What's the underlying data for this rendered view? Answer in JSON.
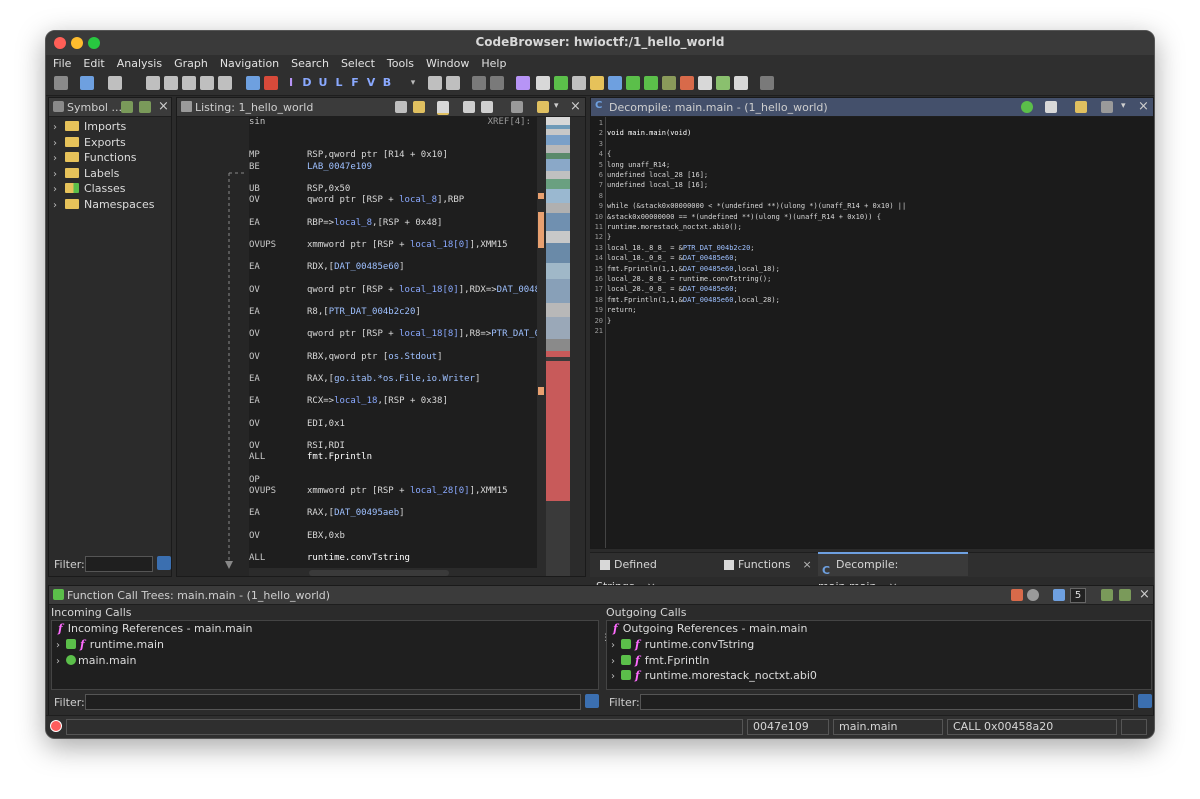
{
  "window": {
    "title": "CodeBrowser: hwioctf:/1_hello_world"
  },
  "menu": [
    "File",
    "Edit",
    "Analysis",
    "Graph",
    "Navigation",
    "Search",
    "Select",
    "Tools",
    "Window",
    "Help"
  ],
  "toolbar": {
    "letters": [
      "I",
      "D",
      "U",
      "L",
      "F",
      "V",
      "B"
    ]
  },
  "symbol_tree": {
    "title": "Symbol ...",
    "items": [
      "Imports",
      "Exports",
      "Functions",
      "Labels",
      "Classes",
      "Namespaces"
    ],
    "filter_label": "Filter:"
  },
  "listing": {
    "title": "Listing:  1_hello_world",
    "xref": "XREF[4]:",
    "lines": [
      {
        "mn": "sin",
        "ops": []
      },
      {
        "mn": "MP",
        "ops": [
          {
            "t": "RSP,qword ptr [R14 + 0x10]",
            "c": "op"
          }
        ]
      },
      {
        "mn": "BE",
        "ops": [
          {
            "t": "LAB_0047e109",
            "c": "dat"
          }
        ]
      },
      {
        "mn": "UB",
        "ops": [
          {
            "t": "RSP,0x50",
            "c": "op"
          }
        ]
      },
      {
        "mn": "OV",
        "ops": [
          {
            "t": "qword ptr [RSP + ",
            "c": "op"
          },
          {
            "t": "local_8",
            "c": "var"
          },
          {
            "t": "],RBP",
            "c": "op"
          }
        ]
      },
      {
        "mn": "EA",
        "ops": [
          {
            "t": "RBP=>",
            "c": "op"
          },
          {
            "t": "local_8",
            "c": "var"
          },
          {
            "t": ",[RSP + 0x48]",
            "c": "op"
          }
        ]
      },
      {
        "mn": "OVUPS",
        "ops": [
          {
            "t": "xmmword ptr [RSP + ",
            "c": "op"
          },
          {
            "t": "local_18[0]",
            "c": "var"
          },
          {
            "t": "],XMM15",
            "c": "op"
          }
        ]
      },
      {
        "mn": "EA",
        "ops": [
          {
            "t": "RDX,[",
            "c": "op"
          },
          {
            "t": "DAT_00485e60",
            "c": "dat"
          },
          {
            "t": "]",
            "c": "op"
          }
        ]
      },
      {
        "mn": "OV",
        "ops": [
          {
            "t": "qword ptr [RSP + ",
            "c": "op"
          },
          {
            "t": "local_18[0]",
            "c": "var"
          },
          {
            "t": "],RDX=>",
            "c": "op"
          },
          {
            "t": "DAT_00485e60",
            "c": "dat"
          }
        ]
      },
      {
        "mn": "EA",
        "ops": [
          {
            "t": "R8,[",
            "c": "op"
          },
          {
            "t": "PTR_DAT_004b2c20",
            "c": "dat"
          },
          {
            "t": "]",
            "c": "op"
          }
        ]
      },
      {
        "mn": "OV",
        "ops": [
          {
            "t": "qword ptr [RSP + ",
            "c": "op"
          },
          {
            "t": "local_18[8]",
            "c": "var"
          },
          {
            "t": "],R8=>",
            "c": "op"
          },
          {
            "t": "PTR_DAT_004b2",
            "c": "dat"
          }
        ]
      },
      {
        "mn": "OV",
        "ops": [
          {
            "t": "RBX,qword ptr [",
            "c": "op"
          },
          {
            "t": "os.Stdout",
            "c": "dat"
          },
          {
            "t": "]",
            "c": "op"
          }
        ]
      },
      {
        "mn": "EA",
        "ops": [
          {
            "t": "RAX,[",
            "c": "op"
          },
          {
            "t": "go.itab.*os.File,io.Writer",
            "c": "dat"
          },
          {
            "t": "]",
            "c": "op"
          }
        ]
      },
      {
        "mn": "EA",
        "ops": [
          {
            "t": "RCX=>",
            "c": "op"
          },
          {
            "t": "local_18",
            "c": "var"
          },
          {
            "t": ",[RSP + 0x38]",
            "c": "op"
          }
        ]
      },
      {
        "mn": "OV",
        "ops": [
          {
            "t": "EDI,0x1",
            "c": "op"
          }
        ]
      },
      {
        "mn": "OV",
        "ops": [
          {
            "t": "RSI,RDI",
            "c": "op"
          }
        ]
      },
      {
        "mn": "ALL",
        "ops": [
          {
            "t": "fmt.Fprintln",
            "c": "fn"
          }
        ]
      },
      {
        "mn": "OP",
        "ops": []
      },
      {
        "mn": "OVUPS",
        "ops": [
          {
            "t": "xmmword ptr [RSP + ",
            "c": "op"
          },
          {
            "t": "local_28[0]",
            "c": "var"
          },
          {
            "t": "],XMM15",
            "c": "op"
          }
        ]
      },
      {
        "mn": "EA",
        "ops": [
          {
            "t": "RAX,[",
            "c": "op"
          },
          {
            "t": "DAT_00495aeb",
            "c": "dat"
          },
          {
            "t": "]",
            "c": "op"
          }
        ]
      },
      {
        "mn": "OV",
        "ops": [
          {
            "t": "EBX,0xb",
            "c": "op"
          }
        ]
      },
      {
        "mn": "ALL",
        "ops": [
          {
            "t": "runtime.convTstring",
            "c": "fn"
          }
        ]
      }
    ]
  },
  "decompile": {
    "title": "Decompile: main.main -  (1_hello_world)",
    "lines": [
      {
        "n": "1",
        "parts": []
      },
      {
        "n": "2",
        "parts": [
          {
            "t": "void main.main(void)",
            "c": "fn"
          }
        ]
      },
      {
        "n": "3",
        "parts": []
      },
      {
        "n": "4",
        "parts": [
          {
            "t": "{",
            "c": "op"
          }
        ]
      },
      {
        "n": "5",
        "parts": [
          {
            "t": "  long unaff_R14;",
            "c": "op"
          }
        ]
      },
      {
        "n": "6",
        "parts": [
          {
            "t": "  undefined local_28 [16];",
            "c": "op"
          }
        ]
      },
      {
        "n": "7",
        "parts": [
          {
            "t": "  undefined local_18 [16];",
            "c": "op"
          }
        ]
      },
      {
        "n": "8",
        "parts": []
      },
      {
        "n": "9",
        "parts": [
          {
            "t": "  while (&stack0x00000000 < *(undefined **)(ulong *)(unaff_R14 + 0x10) ||",
            "c": "op"
          }
        ]
      },
      {
        "n": "10",
        "parts": [
          {
            "t": "         &stack0x00000000 == *(undefined **)(ulong *)(unaff_R14 + 0x10)) {",
            "c": "op"
          }
        ]
      },
      {
        "n": "11",
        "parts": [
          {
            "t": "    runtime.morestack_noctxt.abi0();",
            "c": "op"
          }
        ]
      },
      {
        "n": "12",
        "parts": [
          {
            "t": "  }",
            "c": "op"
          }
        ]
      },
      {
        "n": "13",
        "parts": [
          {
            "t": "  local_18._8_8_ = &",
            "c": "op"
          },
          {
            "t": "PTR_DAT_004b2c20",
            "c": "dat"
          },
          {
            "t": ";",
            "c": "op"
          }
        ]
      },
      {
        "n": "14",
        "parts": [
          {
            "t": "  local_18._0_8_ = &",
            "c": "op"
          },
          {
            "t": "DAT_00485e60",
            "c": "dat"
          },
          {
            "t": ";",
            "c": "op"
          }
        ]
      },
      {
        "n": "15",
        "parts": [
          {
            "t": "  fmt.Fprintln(1,1,&",
            "c": "op"
          },
          {
            "t": "DAT_00485e60",
            "c": "dat"
          },
          {
            "t": ",local_18);",
            "c": "op"
          }
        ]
      },
      {
        "n": "16",
        "parts": [
          {
            "t": "  local_28._8_8_ = runtime.convTstring();",
            "c": "op"
          }
        ]
      },
      {
        "n": "17",
        "parts": [
          {
            "t": "  local_28._0_8_ = &",
            "c": "op"
          },
          {
            "t": "DAT_00485e60",
            "c": "dat"
          },
          {
            "t": ";",
            "c": "op"
          }
        ]
      },
      {
        "n": "18",
        "parts": [
          {
            "t": "  fmt.Fprintln(1,1,&",
            "c": "op"
          },
          {
            "t": "DAT_00485e60",
            "c": "dat"
          },
          {
            "t": ",local_28);",
            "c": "op"
          }
        ]
      },
      {
        "n": "19",
        "parts": [
          {
            "t": "  return;",
            "c": "op"
          }
        ]
      },
      {
        "n": "20",
        "parts": [
          {
            "t": "}",
            "c": "op"
          }
        ]
      },
      {
        "n": "21",
        "parts": []
      }
    ]
  },
  "tabs": [
    {
      "label": "Defined Strings",
      "close": "×"
    },
    {
      "label": "Functions",
      "close": "×"
    },
    {
      "label": "Decompile: main.main",
      "close": "×"
    }
  ],
  "call_trees": {
    "title": "Function Call Trees: main.main -  (1_hello_world)",
    "depth": "5",
    "incoming": {
      "heading": "Incoming Calls",
      "root": "Incoming References - main.main",
      "items": [
        "runtime.main",
        "main.main"
      ]
    },
    "outgoing": {
      "heading": "Outgoing Calls",
      "root": "Outgoing References - main.main",
      "items": [
        "runtime.convTstring",
        "fmt.Fprintln",
        "runtime.morestack_noctxt.abi0"
      ]
    },
    "filter_label": "Filter:"
  },
  "status": {
    "address": "0047e109",
    "function": "main.main",
    "instruction": "CALL 0x00458a20"
  },
  "colors": {
    "accent": "#44506b",
    "folder": "#e6c25a",
    "func": "#ff6bff",
    "ok": "#5bbf4a",
    "listing_bg": "#1e1e1e",
    "decomp_bg": "#1b1b1b"
  }
}
